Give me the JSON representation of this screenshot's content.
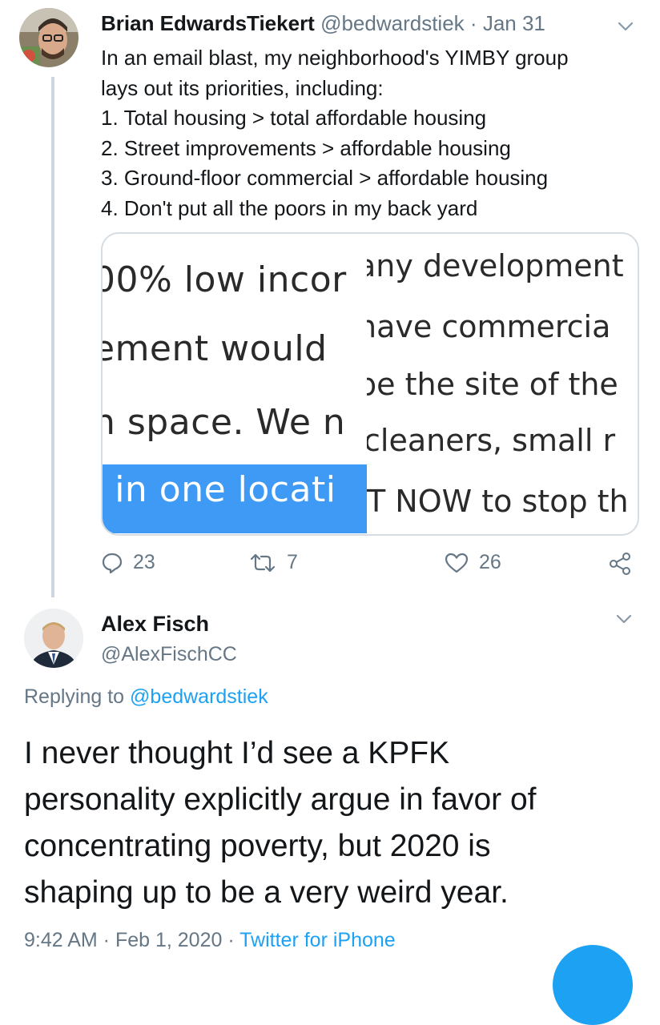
{
  "tweet1": {
    "author_name": "Brian EdwardsTiekert",
    "handle": "@bedwardstiek",
    "separator": "·",
    "date": "Jan 31",
    "lines": [
      "In an email blast, my neighborhood's YIMBY group",
      "lays out its priorities, including:",
      "1. Total housing > total affordable housing",
      "2. Street improvements > affordable housing",
      "3. Ground-floor commercial > affordable housing",
      "4. Don't put all the poors in my back yard"
    ],
    "image": {
      "left_fragments": [
        "00% low incor",
        "ement would",
        "n space. We n",
        "l in one locati"
      ],
      "right_fragments": [
        "any development",
        "have commercia",
        "be the site of the",
        "cleaners, small r",
        "T NOW to stop th"
      ]
    },
    "stats": {
      "replies": "23",
      "retweets": "7",
      "likes": "26"
    }
  },
  "tweet2": {
    "author_name": "Alex Fisch",
    "handle": "@AlexFischCC",
    "replying_prefix": "Replying to ",
    "replying_to": "@bedwardstiek",
    "lines": [
      "I never thought I’d see a KPFK",
      "personality explicitly argue in favor of",
      "concentrating poverty, but 2020 is",
      "shaping up to be a very weird year."
    ],
    "time": "9:42 AM",
    "separator": " · ",
    "date": "Feb 1, 2020",
    "source": "Twitter for iPhone"
  },
  "colors": {
    "accent": "#1da1f2",
    "secondary_text": "#657786",
    "primary_text": "#14171a",
    "highlight": "#3e9af4",
    "thread_line": "#cdd5de"
  },
  "icons": {
    "reply": "reply-icon",
    "retweet": "retweet-icon",
    "like": "heart-icon",
    "share": "share-icon",
    "more": "chevron-down-icon",
    "compose": "compose-fab"
  }
}
